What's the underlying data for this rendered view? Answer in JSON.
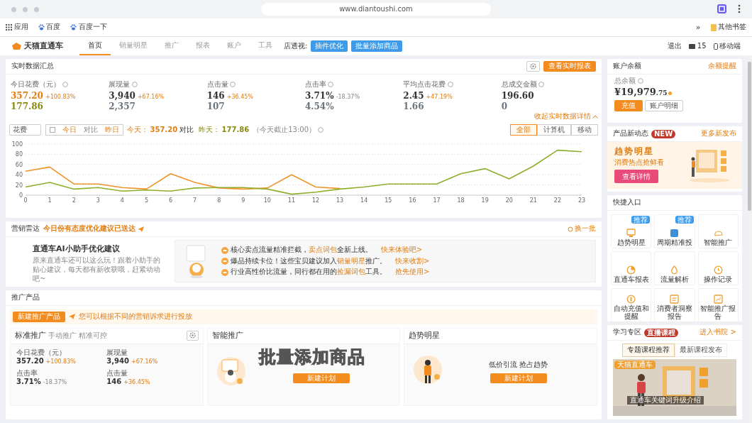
{
  "browser": {
    "url": "www.diantoushi.com",
    "bookmarks": [
      "应用",
      "百度",
      "百度一下"
    ],
    "more": "»",
    "other_bookmarks": "其他书签"
  },
  "app_nav": {
    "logo": "天猫直通车",
    "tabs": [
      {
        "label": "首页",
        "selected": true
      },
      {
        "label": "销量明星",
        "selected": false
      },
      {
        "label": "推广",
        "selected": false
      },
      {
        "label": "报表",
        "selected": false
      },
      {
        "label": "账户",
        "selected": false
      },
      {
        "label": "工具",
        "selected": false
      }
    ],
    "shop_label": "店透视:",
    "shop_buttons": [
      "插件优化",
      "批量添加商品"
    ],
    "logout": "退出",
    "messages": "15",
    "mobile": "移动端"
  },
  "realtime": {
    "title": "实时数据汇总",
    "report_button": "查看实时报表",
    "metrics": [
      {
        "label": "今日花费（元）",
        "value": "357.20",
        "change": "+100.83%",
        "previous": "177.86",
        "highlight": true
      },
      {
        "label": "展现量",
        "value": "3,940",
        "change": "+67.16%",
        "previous": "2,357",
        "highlight": false
      },
      {
        "label": "点击量",
        "value": "146",
        "change": "+36.45%",
        "previous": "107",
        "highlight": false
      },
      {
        "label": "点击率",
        "value": "3.71%",
        "change": "-18.37%",
        "previous": "4.54%",
        "highlight": false
      },
      {
        "label": "平均点击花费",
        "value": "2.45",
        "change": "+47.19%",
        "previous": "1.66",
        "highlight": false
      },
      {
        "label": "总成交金额",
        "value": "196.60",
        "previous": "0",
        "highlight": false
      }
    ],
    "collapse_link": "收起实时数据详情",
    "metric_select": "花费",
    "date_range": [
      "今日",
      "对比",
      "昨日"
    ],
    "summary": {
      "today_label": "今天：",
      "today_value": "357.20",
      "compare": "对比",
      "yesterday_label": "昨天：",
      "yesterday_value": "177.86",
      "note": "（今天截止13:00）"
    },
    "devices": [
      {
        "label": "全部",
        "selected": true
      },
      {
        "label": "计算机",
        "selected": false
      },
      {
        "label": "移动",
        "selected": false
      }
    ],
    "chart_data": {
      "type": "line",
      "x": [
        0,
        1,
        2,
        3,
        4,
        5,
        6,
        7,
        8,
        9,
        10,
        11,
        12,
        13,
        14,
        15,
        16,
        17,
        18,
        19,
        20,
        21,
        22,
        23
      ],
      "xlim": [
        0,
        23
      ],
      "xticks": [
        0,
        1,
        2,
        3,
        4,
        5,
        6,
        7,
        8,
        9,
        10,
        11,
        12,
        13,
        14,
        15,
        16,
        17,
        18,
        19,
        20,
        21,
        22,
        23
      ],
      "ylim": [
        0,
        100
      ],
      "yticks": [
        0,
        20,
        40,
        60,
        80,
        100
      ],
      "grid": true,
      "series": [
        {
          "color": "#f0932b",
          "values": [
            47,
            55,
            22,
            22,
            15,
            12,
            42,
            25,
            14,
            12,
            14,
            40,
            16,
            13,
            null,
            null,
            null,
            null,
            null,
            null,
            null,
            null,
            null,
            null
          ]
        },
        {
          "color": "#8fae2c",
          "values": [
            16,
            25,
            12,
            15,
            8,
            10,
            8,
            14,
            15,
            15,
            12,
            2,
            6,
            12,
            16,
            22,
            22,
            22,
            42,
            52,
            32,
            57,
            88,
            85
          ]
        }
      ]
    }
  },
  "radar": {
    "title": "营销雷达",
    "tagline": "今日份有态度优化建议已送达",
    "refresh": "换一批",
    "assistant_title": "直通车AI小助手优化建议",
    "assistant_text": "原来直通车还可以这么玩！跟着小助手的贴心建议，每天都有新收获哦，赶紧动动吧~",
    "tips": [
      {
        "text": "核心卖点流量精准拦截，**卖点词包**全新上线。",
        "link": "快来体验吧>"
      },
      {
        "text": "爆品持续卡位！这些宝贝建议加入**销量明星**推广。",
        "link": "快来收割>"
      },
      {
        "text": "行业高性价比流量，同行都在用的**捡漏词包**工具。",
        "link": "抢先使用>"
      }
    ]
  },
  "products": {
    "title": "推广产品",
    "new_button": "新建推广产品",
    "notice": "您可以根据不同的营销诉求进行投放",
    "standard": {
      "title": "标准推广",
      "subtitle": "手动推广 精准可控",
      "metrics": [
        {
          "label": "今日花费（元）",
          "value": "357.20",
          "change": "+100.83%"
        },
        {
          "label": "展现量",
          "value": "3,940",
          "change": "+67.16%"
        },
        {
          "label": "点击率",
          "value": "3.71%",
          "change": "-18.37%"
        },
        {
          "label": "点击量",
          "value": "146",
          "change": "+36.45%"
        }
      ]
    },
    "smart": {
      "title": "智能推广",
      "button": "新建计划"
    },
    "trend": {
      "title": "趋势明星",
      "slogan": "低价引流 抢占趋势",
      "button": "新建计划"
    }
  },
  "caption": "批量添加商品",
  "balance": {
    "title": "账户余额",
    "link": "余额提醒",
    "total_label": "总余额",
    "amount": "¥19,979",
    "cents": ".75",
    "buttons": [
      "充值",
      "账户明细"
    ]
  },
  "news": {
    "title": "产品新动态",
    "badge": "NEW",
    "link": "更多新发布",
    "banner_title": "趋势明星",
    "banner_subtitle": "消费热点抢鲜看",
    "banner_button": "查看详情"
  },
  "quick": {
    "title": "快捷入口",
    "items": [
      {
        "label": "趋势明星",
        "badge": "推荐"
      },
      {
        "label": "周期精准投",
        "badge": "推荐"
      },
      {
        "label": "智能推广"
      },
      {
        "label": "直通车报表"
      },
      {
        "label": "流量解析"
      },
      {
        "label": "操作记录"
      },
      {
        "label": "自动充值和提醒"
      },
      {
        "label": "消费者洞察报告"
      },
      {
        "label": "智能推广报告"
      }
    ]
  },
  "learn": {
    "title": "学习专区",
    "badge": "直播课程",
    "link": "进入书院 >",
    "tabs": [
      {
        "label": "专题课程推荐",
        "selected": true
      },
      {
        "label": "最新课程发布",
        "selected": false
      }
    ],
    "video_tag": "天猫直通车",
    "video_title": "直通车关键词升级介绍"
  }
}
